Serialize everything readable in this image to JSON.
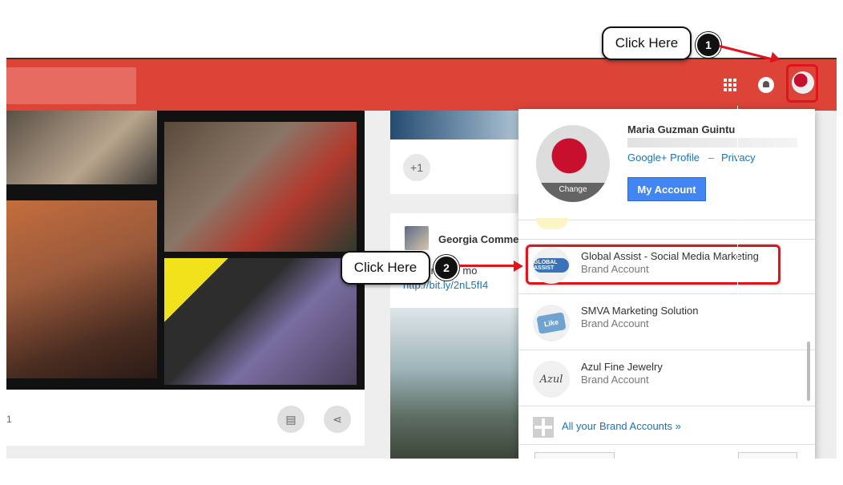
{
  "callouts": [
    {
      "label": "Click Here",
      "number": "1"
    },
    {
      "label": "Click Here",
      "number": "2"
    }
  ],
  "feed": {
    "left_card": {
      "count_text": "1",
      "comment_icon": "comment-icon",
      "share_icon": "share-icon"
    },
    "plus_one_label": "+1",
    "mid_post": {
      "author": "Georgia Comme",
      "text": "...setting the mo",
      "link": "http://bit.ly/2nL5fI4"
    }
  },
  "account_menu": {
    "profile_name": "Maria Guzman Guintu",
    "change_label": "Change",
    "google_profile_link": "Google+ Profile",
    "separator": "–",
    "privacy_link": "Privacy",
    "my_account_button": "My Account",
    "accounts": [
      {
        "name": "Global Assist - Social Media Marketing",
        "subtitle": "Brand Account",
        "logo_text": "GLOBAL ASSIST"
      },
      {
        "name": "SMVA Marketing Solution",
        "subtitle": "Brand Account",
        "logo_text": "Like"
      },
      {
        "name": "Azul Fine Jewelry",
        "subtitle": "Brand Account",
        "logo_text": "Azul"
      }
    ],
    "all_brand_accounts_link": "All your Brand Accounts »"
  },
  "colors": {
    "header_red": "#db4437",
    "highlight_red": "#e0141b",
    "link_blue": "#1a73b8",
    "button_blue": "#4285f4"
  }
}
